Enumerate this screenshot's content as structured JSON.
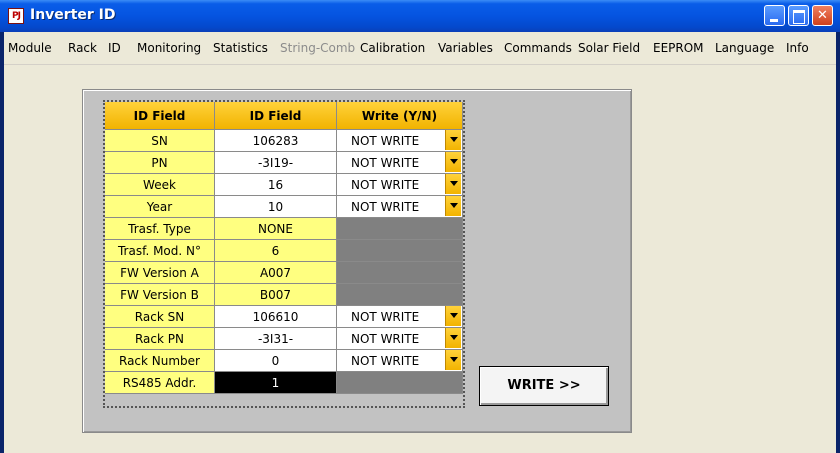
{
  "window": {
    "title": "Inverter ID",
    "icon_label": "PJ"
  },
  "menu": [
    "Module",
    "Rack",
    "ID",
    "Monitoring",
    "Statistics",
    "String-Comb",
    "Calibration",
    "Variables",
    "Commands",
    "Solar Field",
    "EEPROM",
    "Language",
    "Info"
  ],
  "menu_disabled": [
    "String-Comb"
  ],
  "table": {
    "headers": [
      "ID Field",
      "ID Field",
      "Write (Y/N)"
    ],
    "rows": [
      {
        "label": "SN",
        "value": "106283",
        "write": "NOT WRITE"
      },
      {
        "label": "PN",
        "value": "-3I19-",
        "write": "NOT WRITE"
      },
      {
        "label": "Week",
        "value": "16",
        "write": "NOT WRITE"
      },
      {
        "label": "Year",
        "value": "10",
        "write": "NOT WRITE"
      },
      {
        "label": "Trasf. Type",
        "value": "NONE",
        "write": null
      },
      {
        "label": "Trasf. Mod. N°",
        "value": "6",
        "write": null
      },
      {
        "label": "FW Version A",
        "value": "A007",
        "write": null
      },
      {
        "label": "FW Version B",
        "value": "B007",
        "write": null
      },
      {
        "label": "Rack SN",
        "value": "106610",
        "write": "NOT WRITE"
      },
      {
        "label": "Rack PN",
        "value": "-3I31-",
        "write": "NOT WRITE"
      },
      {
        "label": "Rack Number",
        "value": "0",
        "write": "NOT WRITE"
      },
      {
        "label": "RS485 Addr.",
        "value": "1",
        "write": null
      }
    ]
  },
  "write_button_label": "WRITE >>",
  "colors": {
    "header": "#f2b300",
    "label_cell": "#ffff80",
    "panel": "#c2c2c2",
    "titlebar": "#0554e0"
  }
}
